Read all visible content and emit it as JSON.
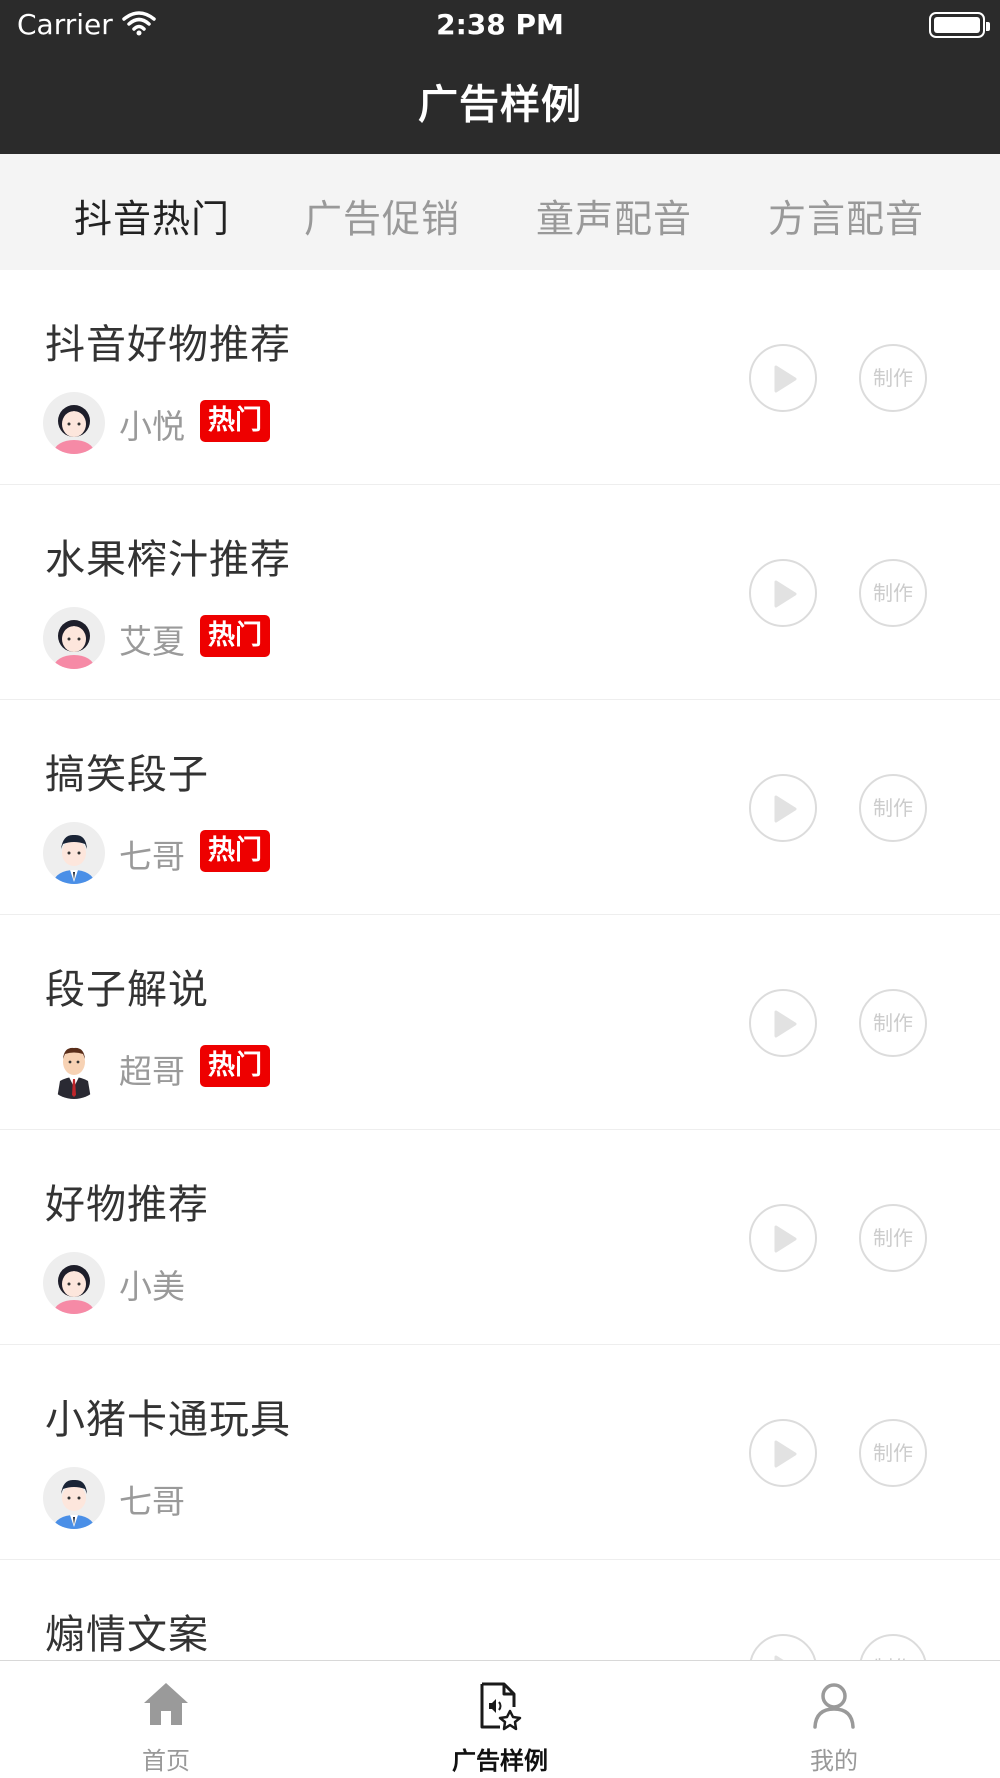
{
  "status_bar": {
    "carrier": "Carrier",
    "time": "2:38 PM"
  },
  "nav": {
    "title": "广告样例"
  },
  "tabs": [
    {
      "label": "抖音热门",
      "active": true
    },
    {
      "label": "广告促销",
      "active": false
    },
    {
      "label": "童声配音",
      "active": false
    },
    {
      "label": "方言配音",
      "active": false
    }
  ],
  "items": [
    {
      "title": "抖音好物推荐",
      "voice": "小悦",
      "badge": "热门",
      "avatar": "female-avatar-icon"
    },
    {
      "title": "水果榨汁推荐",
      "voice": "艾夏",
      "badge": "热门",
      "avatar": "female-avatar-icon"
    },
    {
      "title": "搞笑段子",
      "voice": "七哥",
      "badge": "热门",
      "avatar": "male-avatar-icon"
    },
    {
      "title": "段子解说",
      "voice": "超哥",
      "badge": "热门",
      "avatar": "man-suit-avatar-icon"
    },
    {
      "title": "好物推荐",
      "voice": "小美",
      "avatar": "female-avatar-icon"
    },
    {
      "title": "小猪卡通玩具",
      "voice": "七哥",
      "avatar": "male-avatar-icon"
    },
    {
      "title": "煽情文案"
    }
  ],
  "row_actions": {
    "make_label": "制作",
    "play_icon": "play-icon"
  },
  "bottom_nav": [
    {
      "label": "首页",
      "icon": "home-icon",
      "active": false
    },
    {
      "label": "广告样例",
      "icon": "audio-file-star-icon",
      "active": true
    },
    {
      "label": "我的",
      "icon": "user-icon",
      "active": false
    }
  ],
  "colors": {
    "header_bg": "#2b2b2b",
    "tab_bg": "#f4f4f4",
    "badge": "#ee0000",
    "muted": "#999999"
  }
}
